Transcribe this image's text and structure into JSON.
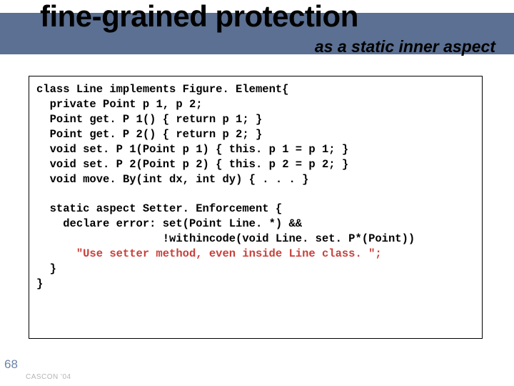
{
  "header": {
    "title": "fine-grained protection",
    "subtitle": "as a static inner aspect"
  },
  "code": {
    "l1a": "class",
    "l1b": " Line ",
    "l1c": "implements",
    "l1d": " Figure. Element{",
    "l2a": "private",
    "l2b": " Point p 1, p 2;",
    "l3a": "Point get. P 1() { ",
    "l3b": "return",
    "l3c": " p 1; }",
    "l4a": "Point get. P 2() { ",
    "l4b": "return",
    "l4c": " p 2; }",
    "l5a": "void",
    "l5b": " set. P 1(Point p 1) { ",
    "l5c": "this",
    "l5d": ". p 1 = p 1; }",
    "l6a": "void",
    "l6b": " set. P 2(Point p 2) { ",
    "l6c": "this",
    "l6d": ". p 2 = p 2; }",
    "l7a": "void",
    "l7b": " move. By(",
    "l7c": "int",
    "l7d": " dx, ",
    "l7e": "int",
    "l7f": " dy) { . . . }",
    "l9a": "static aspect",
    "l9b": " Setter. Enforcement {",
    "l10a": "declare error",
    "l10b": ": set(Point Line. *) &&",
    "l11": "!withincode(void Line. set. P*(Point))",
    "l12": "\"Use setter method, even inside Line class. \";",
    "l13": "}",
    "l14": "}"
  },
  "footer": {
    "page": "68",
    "conf": "CASCON '04"
  }
}
